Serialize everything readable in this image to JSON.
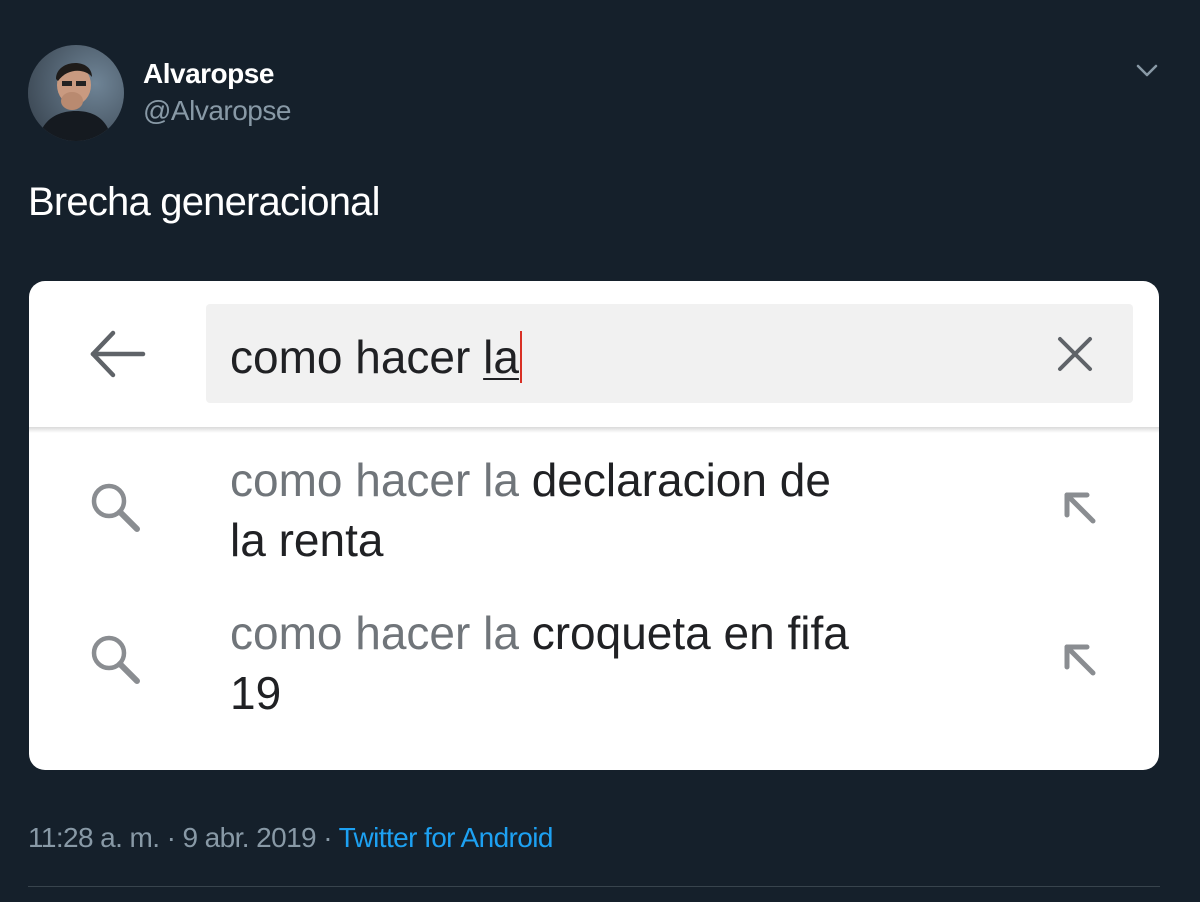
{
  "author": {
    "name": "Alvaropse",
    "handle": "@Alvaropse",
    "avatar_icon": "profile-photo"
  },
  "menu_icon": "chevron-down-icon",
  "tweet": {
    "text": "Brecha generacional"
  },
  "screenshot": {
    "back_icon": "arrow-left-icon",
    "search": {
      "prefix": "como hacer ",
      "typed": "la",
      "clear_icon": "close-icon"
    },
    "suggestions": [
      {
        "prefix": "como hacer la ",
        "completion": "declaracion de la renta",
        "icon": "search-icon",
        "fill_icon": "arrow-up-left-icon"
      },
      {
        "prefix": "como hacer la ",
        "completion": "croqueta en fifa 19",
        "icon": "search-icon",
        "fill_icon": "arrow-up-left-icon"
      }
    ]
  },
  "meta": {
    "timestamp": "11:28 a. m. · 9 abr. 2019 · ",
    "source": "Twitter for Android"
  },
  "colors": {
    "background": "#15202b",
    "secondary_text": "#8899a6",
    "link": "#1da1f2",
    "cursor": "#d93025"
  }
}
